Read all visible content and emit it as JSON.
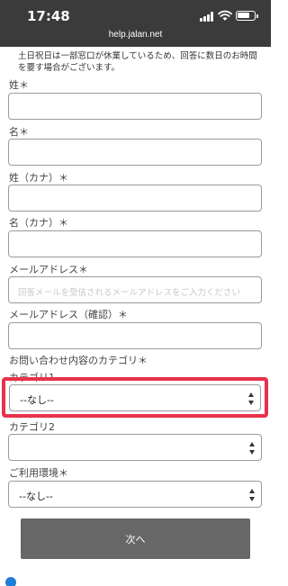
{
  "status_bar": {
    "time": "17:48"
  },
  "browser": {
    "url": "help.jalan.net"
  },
  "notice": "土日祝日は一部窓口が休業しているため、回答に数日のお時間を要す場合がございます。",
  "form": {
    "last_name_label": "姓＊",
    "first_name_label": "名＊",
    "last_name_kana_label": "姓（カナ）＊",
    "first_name_kana_label": "名（カナ）＊",
    "email_label": "メールアドレス＊",
    "email_placeholder": "回答メールを受信されるメールアドレスをご入力ください",
    "email_confirm_label": "メールアドレス（確認）＊",
    "category_heading": "お問い合わせ内容のカテゴリ＊",
    "category1_label": "カテゴリ1",
    "category1_value": "--なし--",
    "category2_label": "カテゴリ2",
    "category2_value": "",
    "environment_label": "ご利用環境＊",
    "environment_value": "--なし--",
    "next_button": "次へ"
  },
  "colors": {
    "highlight": "#e8314a",
    "button": "#676767",
    "header": "#3b3b3b"
  }
}
